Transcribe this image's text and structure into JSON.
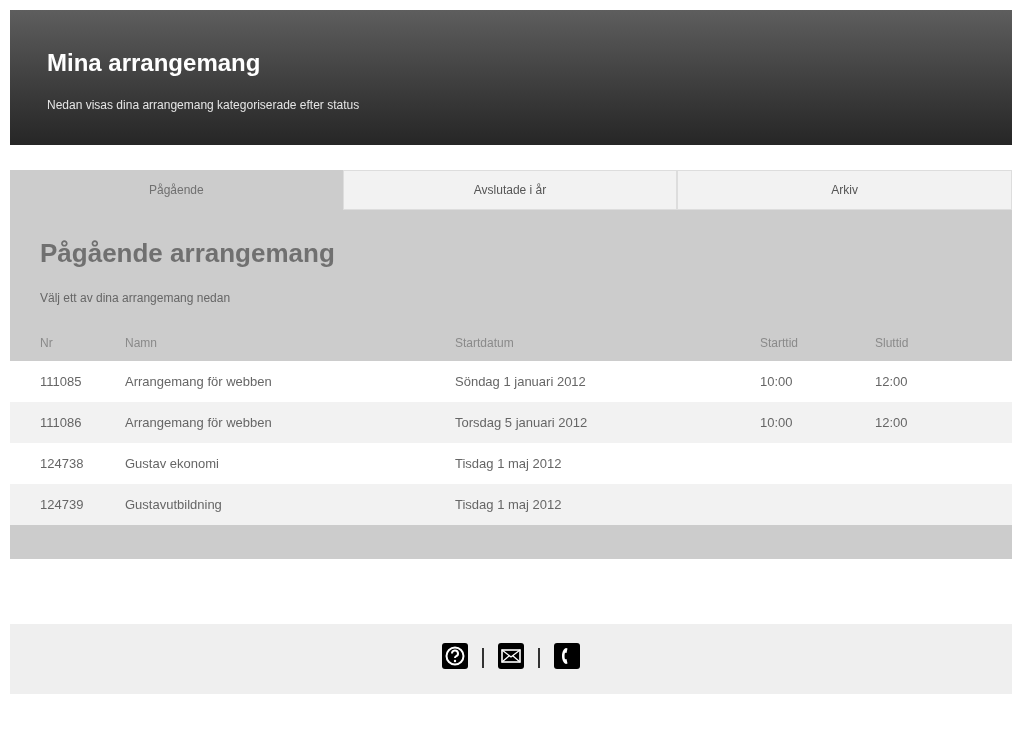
{
  "header": {
    "title": "Mina arrangemang",
    "subtitle": "Nedan visas dina arrangemang kategoriserade efter status"
  },
  "tabs": [
    {
      "label": "Pågående",
      "selected": true
    },
    {
      "label": "Avslutade i år",
      "selected": false
    },
    {
      "label": "Arkiv",
      "selected": false
    }
  ],
  "panel": {
    "title": "Pågående arrangemang",
    "subtitle": "Välj ett av dina arrangemang nedan"
  },
  "table": {
    "columns": [
      "Nr",
      "Namn",
      "Startdatum",
      "Starttid",
      "Sluttid"
    ],
    "rows": [
      [
        "111085",
        "Arrangemang för webben",
        "Söndag 1 januari 2012",
        "10:00",
        "12:00"
      ],
      [
        "111086",
        "Arrangemang för webben",
        "Torsdag 5 januari 2012",
        "10:00",
        "12:00"
      ],
      [
        "124738",
        "Gustav ekonomi",
        "Tisdag 1 maj 2012",
        "",
        ""
      ],
      [
        "124739",
        "Gustavutbildning",
        "Tisdag 1 maj 2012",
        "",
        ""
      ]
    ]
  },
  "footer": {
    "icons": [
      {
        "kind": "help"
      },
      {
        "kind": "mail"
      },
      {
        "kind": "phone"
      }
    ]
  }
}
